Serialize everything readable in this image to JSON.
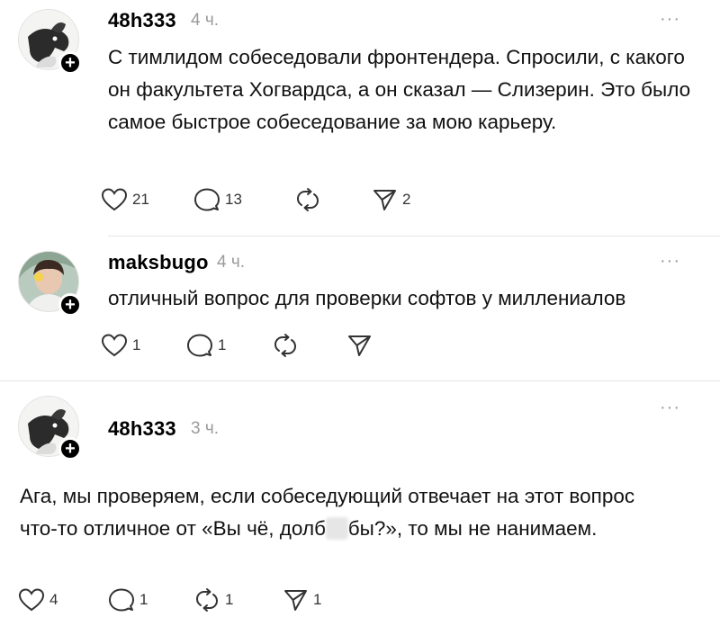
{
  "posts": [
    {
      "username": "48h333",
      "time": "4 ч.",
      "more": "···",
      "text": "С тимлидом собеседовали фронтендера. Спросили, с какого он факультета Хогвардса, а он сказал — Слизерин. Это было самое быстрое собеседование за мою карьеру.",
      "likes": "21",
      "comments": "13",
      "reposts": "",
      "shares": "2"
    },
    {
      "username": "maksbugo",
      "time": "4 ч.",
      "more": "···",
      "text": "отличный вопрос для проверки софтов у миллениалов",
      "likes": "1",
      "comments": "1",
      "reposts": "",
      "shares": ""
    },
    {
      "username": "48h333",
      "time": "3 ч.",
      "more": "···",
      "text_before": "Ага, мы проверяем, если собеседующий отвечает на  этот вопрос что-то отличное от «Вы чё, долб",
      "text_hidden": "ое",
      "text_after": "бы?», то мы не нанимаем.",
      "likes": "4",
      "comments": "1",
      "reposts": "1",
      "shares": "1"
    }
  ],
  "icons": {
    "like": "heart-icon",
    "comment": "comment-icon",
    "repost": "repost-icon",
    "share": "share-icon",
    "follow": "plus-icon",
    "more": "more-icon"
  }
}
